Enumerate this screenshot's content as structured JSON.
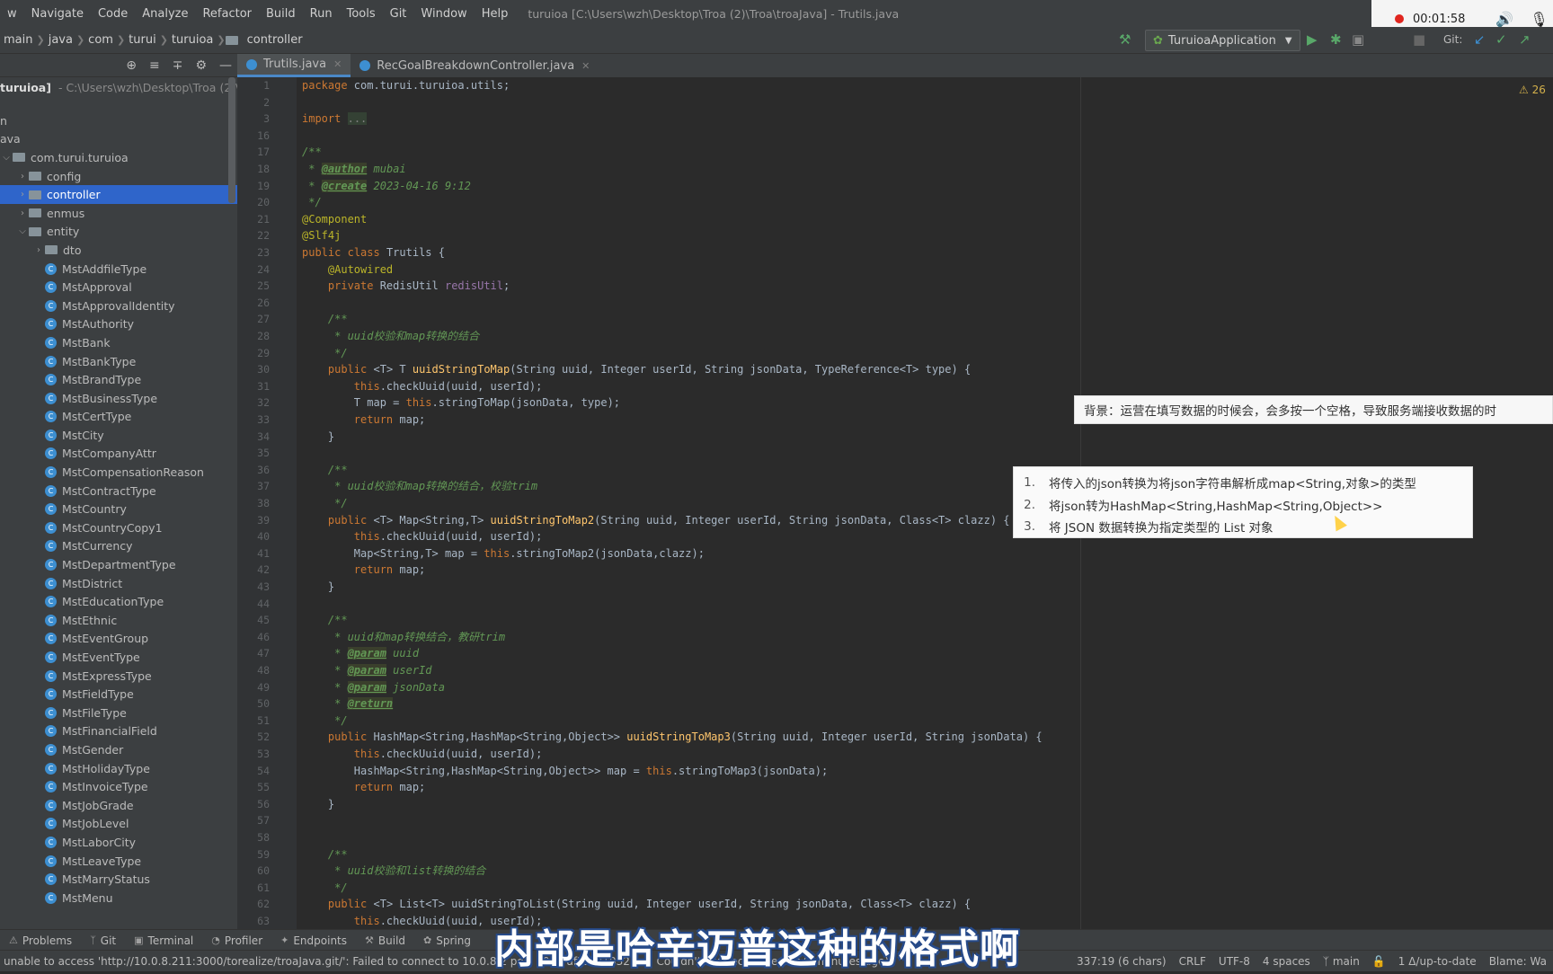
{
  "menu": {
    "items": [
      "w",
      "Navigate",
      "Code",
      "Analyze",
      "Refactor",
      "Build",
      "Run",
      "Tools",
      "Git",
      "Window",
      "Help"
    ],
    "title": "turuioa [C:\\Users\\wzh\\Desktop\\Troa (2)\\Troa\\troaJava] - Trutils.java"
  },
  "recorder": {
    "time": "00:01:58",
    "icons": [
      "record-dot",
      "speaker-icon",
      "mic-icon"
    ]
  },
  "breadcrumb": [
    "main",
    "java",
    "com",
    "turui",
    "turuioa",
    "controller"
  ],
  "toolbar": {
    "run_config": "TuruioaApplication",
    "git_label": "Git:"
  },
  "project": {
    "root_label": "turuioa]",
    "root_path": "- C:\\Users\\wzh\\Desktop\\Troa (2)\\",
    "rows": [
      {
        "label": "n",
        "indent": 0,
        "kind": "text"
      },
      {
        "label": "ava",
        "indent": 0,
        "kind": "text"
      },
      {
        "label": "com.turui.turuioa",
        "indent": 0,
        "kind": "folder"
      },
      {
        "label": "config",
        "indent": 1,
        "kind": "folder"
      },
      {
        "label": "controller",
        "indent": 1,
        "kind": "folder",
        "selected": true
      },
      {
        "label": "enmus",
        "indent": 1,
        "kind": "folder"
      },
      {
        "label": "entity",
        "indent": 1,
        "kind": "folder"
      },
      {
        "label": "dto",
        "indent": 2,
        "kind": "folder"
      },
      {
        "label": "MstAddfileType",
        "indent": 2,
        "kind": "class"
      },
      {
        "label": "MstApproval",
        "indent": 2,
        "kind": "class"
      },
      {
        "label": "MstApprovalIdentity",
        "indent": 2,
        "kind": "class"
      },
      {
        "label": "MstAuthority",
        "indent": 2,
        "kind": "class"
      },
      {
        "label": "MstBank",
        "indent": 2,
        "kind": "class"
      },
      {
        "label": "MstBankType",
        "indent": 2,
        "kind": "class"
      },
      {
        "label": "MstBrandType",
        "indent": 2,
        "kind": "class"
      },
      {
        "label": "MstBusinessType",
        "indent": 2,
        "kind": "class"
      },
      {
        "label": "MstCertType",
        "indent": 2,
        "kind": "class"
      },
      {
        "label": "MstCity",
        "indent": 2,
        "kind": "class"
      },
      {
        "label": "MstCompanyAttr",
        "indent": 2,
        "kind": "class"
      },
      {
        "label": "MstCompensationReason",
        "indent": 2,
        "kind": "class"
      },
      {
        "label": "MstContractType",
        "indent": 2,
        "kind": "class"
      },
      {
        "label": "MstCountry",
        "indent": 2,
        "kind": "class"
      },
      {
        "label": "MstCountryCopy1",
        "indent": 2,
        "kind": "class"
      },
      {
        "label": "MstCurrency",
        "indent": 2,
        "kind": "class"
      },
      {
        "label": "MstDepartmentType",
        "indent": 2,
        "kind": "class"
      },
      {
        "label": "MstDistrict",
        "indent": 2,
        "kind": "class"
      },
      {
        "label": "MstEducationType",
        "indent": 2,
        "kind": "class"
      },
      {
        "label": "MstEthnic",
        "indent": 2,
        "kind": "class"
      },
      {
        "label": "MstEventGroup",
        "indent": 2,
        "kind": "class"
      },
      {
        "label": "MstEventType",
        "indent": 2,
        "kind": "class"
      },
      {
        "label": "MstExpressType",
        "indent": 2,
        "kind": "class"
      },
      {
        "label": "MstFieldType",
        "indent": 2,
        "kind": "class"
      },
      {
        "label": "MstFileType",
        "indent": 2,
        "kind": "class"
      },
      {
        "label": "MstFinancialField",
        "indent": 2,
        "kind": "class"
      },
      {
        "label": "MstGender",
        "indent": 2,
        "kind": "class"
      },
      {
        "label": "MstHolidayType",
        "indent": 2,
        "kind": "class"
      },
      {
        "label": "MstInvoiceType",
        "indent": 2,
        "kind": "class"
      },
      {
        "label": "MstJobGrade",
        "indent": 2,
        "kind": "class"
      },
      {
        "label": "MstJobLevel",
        "indent": 2,
        "kind": "class"
      },
      {
        "label": "MstLaborCity",
        "indent": 2,
        "kind": "class"
      },
      {
        "label": "MstLeaveType",
        "indent": 2,
        "kind": "class"
      },
      {
        "label": "MstMarryStatus",
        "indent": 2,
        "kind": "class"
      },
      {
        "label": "MstMenu",
        "indent": 2,
        "kind": "class"
      }
    ]
  },
  "tabs": [
    {
      "label": "Trutils.java",
      "active": true
    },
    {
      "label": "RecGoalBreakdownController.java",
      "active": false
    }
  ],
  "editor": {
    "warnings": "26",
    "line_numbers": [
      "1",
      "2",
      "3",
      "16",
      "17",
      "18",
      "19",
      "20",
      "21",
      "22",
      "23",
      "24",
      "25",
      "26",
      "27",
      "28",
      "29",
      "30",
      "31",
      "32",
      "33",
      "34",
      "35",
      "36",
      "37",
      "38",
      "39",
      "40",
      "41",
      "42",
      "43",
      "44",
      "45",
      "46",
      "47",
      "48",
      "49",
      "50",
      "51",
      "52",
      "53",
      "54",
      "55",
      "56",
      "57",
      "58",
      "59",
      "60",
      "61",
      "62",
      "63"
    ],
    "code_lines": [
      "package com.turui.turuioa.utils;",
      "",
      "import ...",
      "",
      "/**",
      " * @author mubai",
      " * @create 2023-04-16 9:12",
      " */",
      "@Component",
      "@Slf4j",
      "public class Trutils {",
      "    @Autowired",
      "    private RedisUtil redisUtil;",
      "",
      "    /**",
      "     * uuid校验和map转换的结合",
      "     */",
      "    public <T> T uuidStringToMap(String uuid, Integer userId, String jsonData, TypeReference<T> type) {",
      "        this.checkUuid(uuid, userId);",
      "        T map = this.stringToMap(jsonData, type);",
      "        return map;",
      "    }",
      "",
      "    /**",
      "     * uuid校验和map转换的结合，校验trim",
      "     */",
      "    public <T> Map<String,T> uuidStringToMap2(String uuid, Integer userId, String jsonData, Class<T> clazz) {",
      "        this.checkUuid(uuid, userId);",
      "        Map<String,T> map = this.stringToMap2(jsonData,clazz);",
      "        return map;",
      "    }",
      "",
      "    /**",
      "     * uuid和map转换结合，教研trim",
      "     * @param uuid",
      "     * @param userId",
      "     * @param jsonData",
      "     * @return",
      "     */",
      "    public HashMap<String,HashMap<String,Object>> uuidStringToMap3(String uuid, Integer userId, String jsonData) {",
      "        this.checkUuid(uuid, userId);",
      "        HashMap<String,HashMap<String,Object>> map = this.stringToMap3(jsonData);",
      "        return map;",
      "    }",
      "",
      "",
      "    /**",
      "     * uuid校验和list转换的结合",
      "     */",
      "    public <T> List<T> uuidStringToList(String uuid, Integer userId, String jsonData, Class<T> clazz) {",
      "        this.checkUuid(uuid, userId);"
    ]
  },
  "popup_note": {
    "text": "背景：运营在填写数据的时候会，会多按一个空格，导致服务端接收数据的时"
  },
  "popup_list": {
    "items": [
      {
        "num": "1.",
        "text": "将传入的json转换为将json字符串解析成map<String,对象>的类型"
      },
      {
        "num": "2.",
        "text": "将json转为HashMap<String,HashMap<String,Object>>"
      },
      {
        "num": "3.",
        "text": "将 JSON 数据转换为指定类型的 List 对象"
      }
    ]
  },
  "bottom_tabs": [
    "Problems",
    "Git",
    "Terminal",
    "Profiler",
    "Endpoints",
    "Build",
    "Spring"
  ],
  "status": {
    "message": "unable to access 'http://10.0.8.211:3000/torealize/troaJava.git/': Failed to connect to 10.0.8.2 port 3000 after 21032 ms: Couldn't connect to server (4 minutes ago)",
    "position": "337:19 (6 chars)",
    "line_sep": "CRLF",
    "encoding": "UTF-8",
    "indent": "4 spaces",
    "branch": "main",
    "vcs": "1 Δ/up-to-date",
    "blame": "Blame: Wa"
  },
  "subtitle": "内部是哈辛迈普这种的格式啊",
  "colors": {
    "accent": "#2f65ca",
    "keyword": "#cc7832",
    "annotation": "#bbb529",
    "comment": "#629755",
    "method": "#ffc66d"
  }
}
